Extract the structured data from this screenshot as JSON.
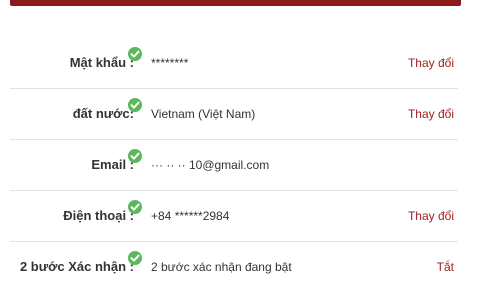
{
  "rows": [
    {
      "label": "Mật khẩu :",
      "value": "********",
      "action": "Thay đổi"
    },
    {
      "label": "đất nước:",
      "value": "Vietnam (Việt Nam)",
      "action": "Thay đổi"
    },
    {
      "label": "Email :",
      "value": "··· ·· ·· 10@gmail.com",
      "action": ""
    },
    {
      "label": "Điện thoại :",
      "value": "+84 ******2984",
      "action": "Thay đổi"
    },
    {
      "label": "2 bước Xác nhận :",
      "value": "2 bước xác nhận đang bật",
      "action": "Tắt"
    }
  ],
  "colors": {
    "accent": "#8b1a1a",
    "action": "#a01f1f",
    "check": "#5cb85c"
  },
  "icons": {
    "status": "check-circle-icon"
  }
}
